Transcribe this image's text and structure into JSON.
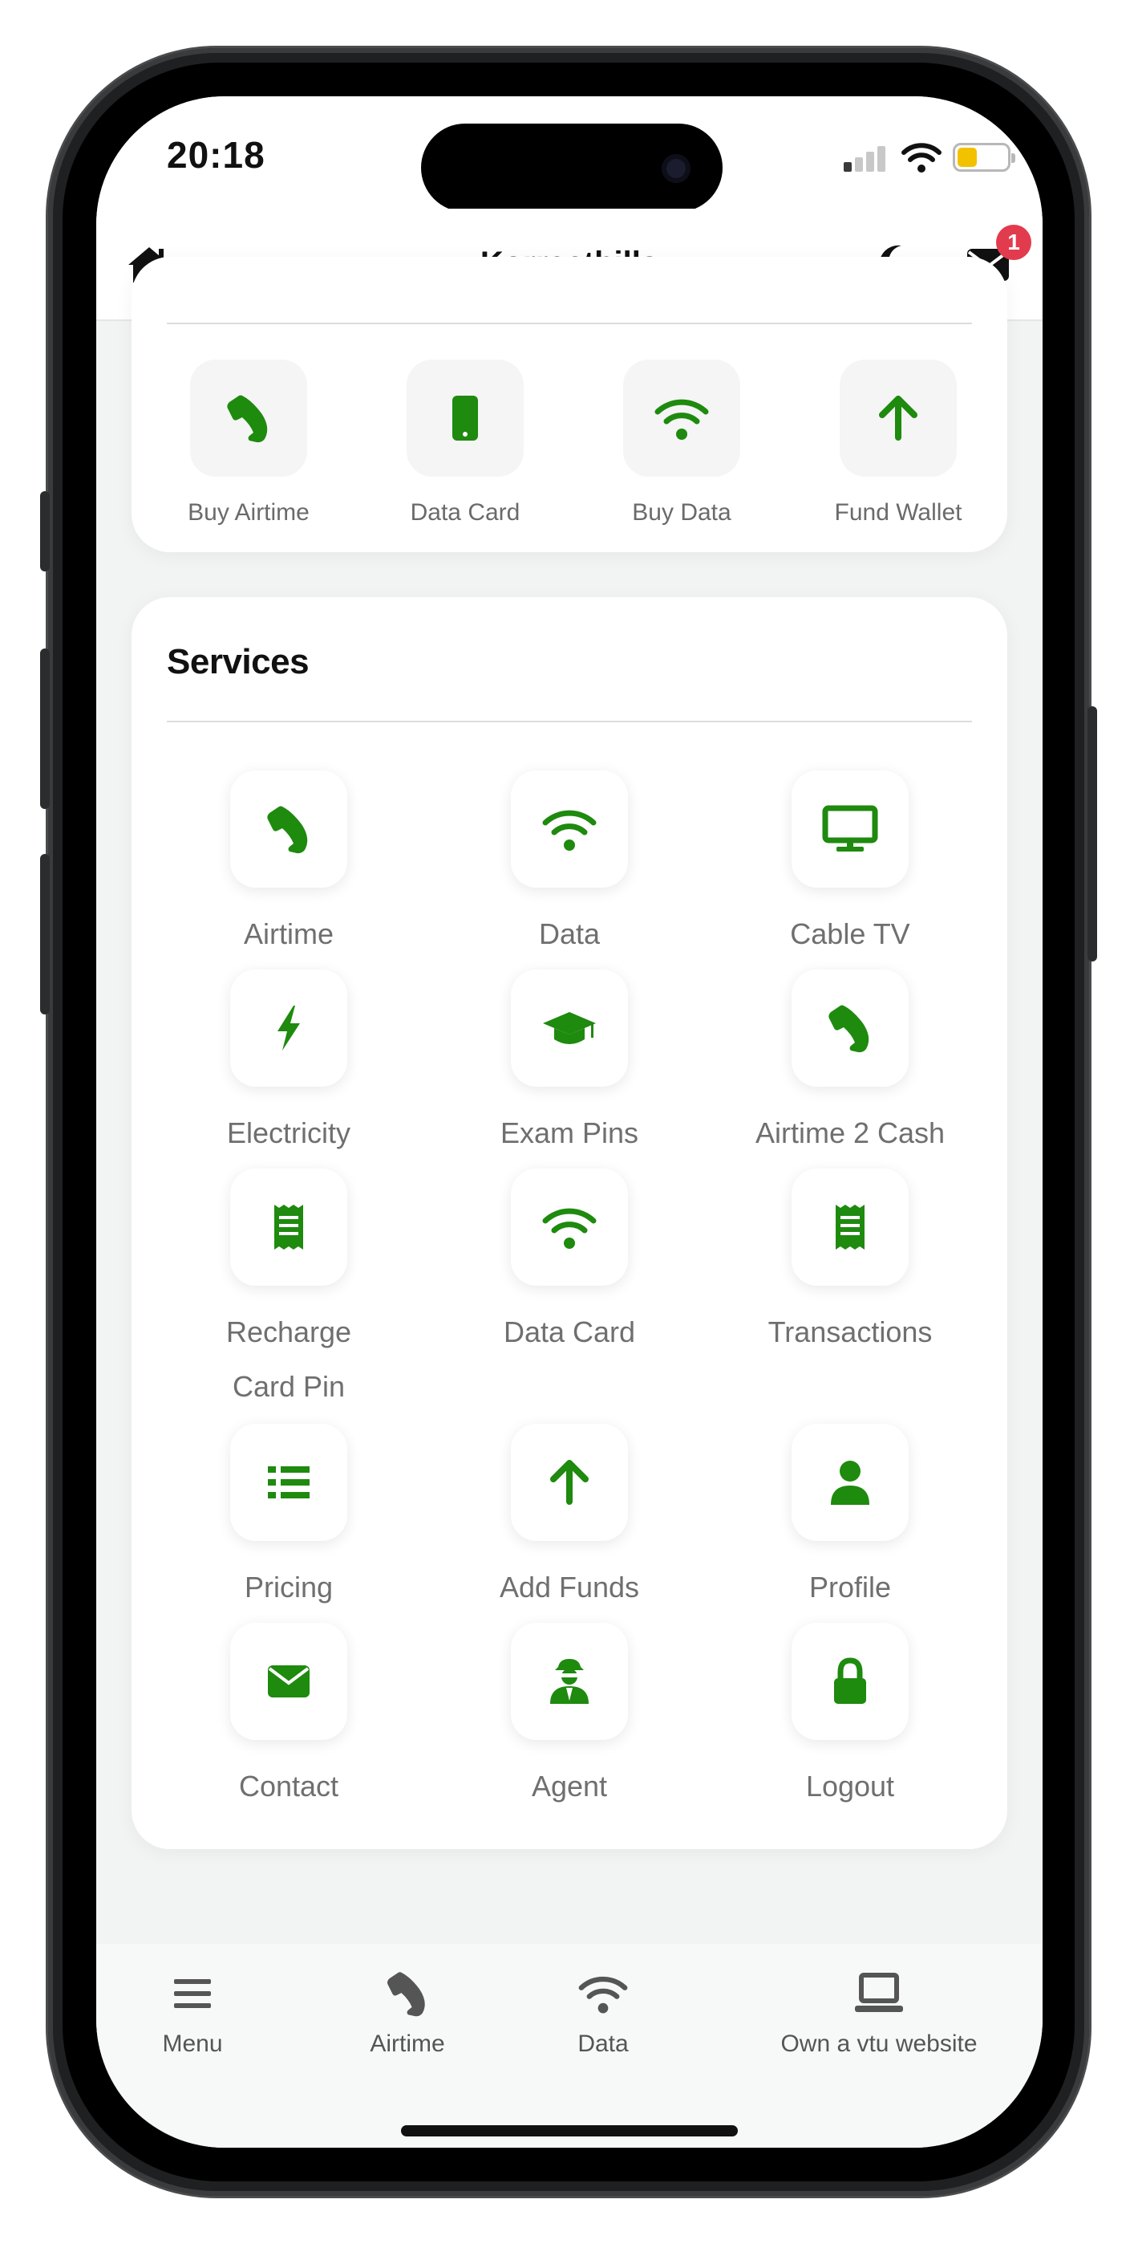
{
  "status_bar": {
    "time": "20:18"
  },
  "header": {
    "title": "Korrectbills",
    "notification_count": "1"
  },
  "quick_actions": [
    {
      "label": "Buy Airtime",
      "icon": "phone-icon"
    },
    {
      "label": "Data Card",
      "icon": "mobile-icon"
    },
    {
      "label": "Buy Data",
      "icon": "wifi-icon"
    },
    {
      "label": "Fund Wallet",
      "icon": "arrow-up-icon"
    }
  ],
  "services": {
    "title": "Services",
    "items": [
      {
        "label": "Airtime",
        "icon": "phone-icon"
      },
      {
        "label": "Data",
        "icon": "wifi-icon"
      },
      {
        "label": "Cable TV",
        "icon": "tv-icon"
      },
      {
        "label": "Electricity",
        "icon": "bolt-icon"
      },
      {
        "label": "Exam Pins",
        "icon": "graduation-cap-icon"
      },
      {
        "label": "Airtime 2 Cash",
        "icon": "phone-icon"
      },
      {
        "label": "Recharge Card Pin",
        "icon": "receipt-icon"
      },
      {
        "label": "Data Card",
        "icon": "wifi-icon"
      },
      {
        "label": "Transactions",
        "icon": "receipt-icon"
      },
      {
        "label": "Pricing",
        "icon": "list-icon"
      },
      {
        "label": "Add Funds",
        "icon": "arrow-up-icon"
      },
      {
        "label": "Profile",
        "icon": "user-icon"
      },
      {
        "label": "Contact",
        "icon": "envelope-icon"
      },
      {
        "label": "Agent",
        "icon": "agent-icon"
      },
      {
        "label": "Logout",
        "icon": "lock-icon"
      }
    ]
  },
  "bottom_nav": [
    {
      "label": "Menu",
      "icon": "menu-icon"
    },
    {
      "label": "Airtime",
      "icon": "phone-icon"
    },
    {
      "label": "Data",
      "icon": "wifi-icon"
    },
    {
      "label": "Own a vtu website",
      "icon": "laptop-icon"
    }
  ],
  "colors": {
    "accent": "#1e8a0e",
    "badge": "#e23b4e",
    "nav_icon": "#555555"
  }
}
